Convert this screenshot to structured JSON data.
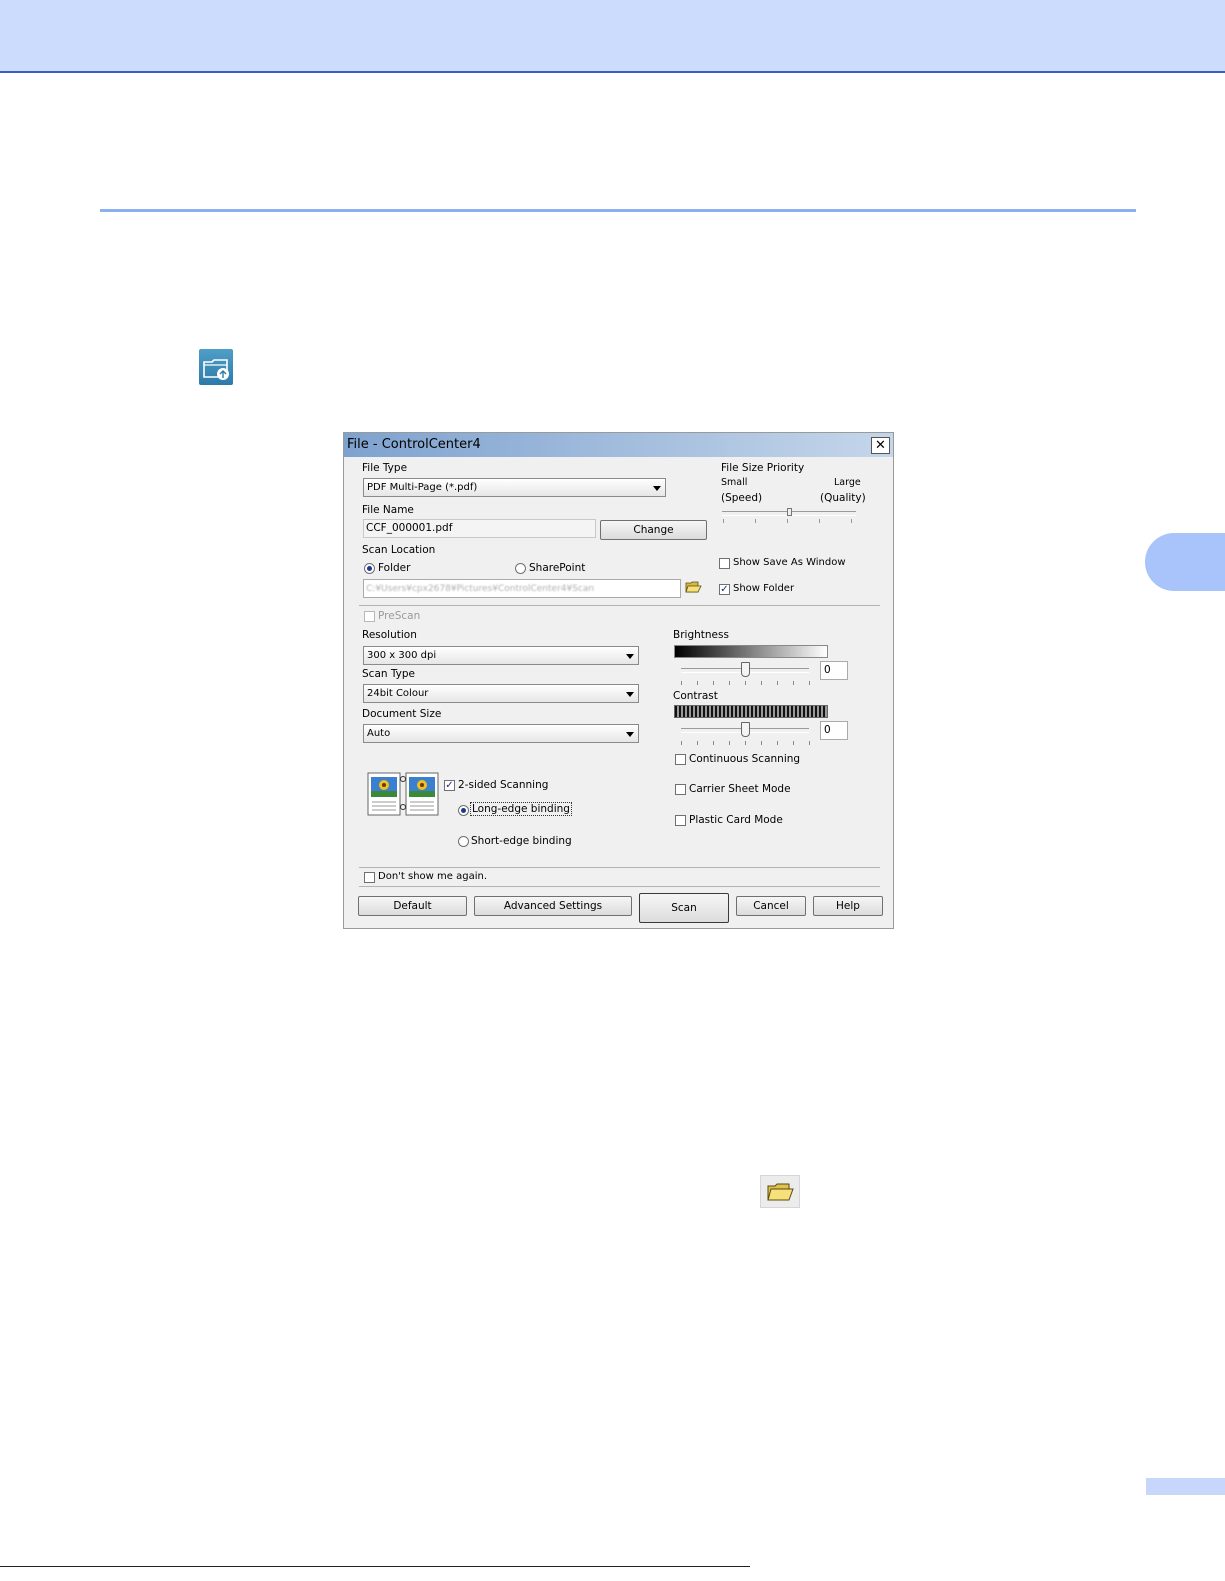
{
  "dialog": {
    "title": "File - ControlCenter4",
    "close_glyph": "✕",
    "file_type": {
      "label": "File Type",
      "value": "PDF Multi-Page (*.pdf)"
    },
    "file_size_priority": {
      "label": "File Size Priority",
      "small": "Small",
      "large": "Large",
      "speed": "(Speed)",
      "quality": "(Quality)",
      "level": 0.5
    },
    "file_name": {
      "label": "File Name",
      "value": "CCF_000001.pdf",
      "change_button": "Change"
    },
    "scan_location": {
      "label": "Scan Location",
      "folder": "Folder",
      "sharepoint": "SharePoint",
      "selected": "Folder",
      "path": "C:¥Users¥cpx2678¥Pictures¥ControlCenter4¥Scan"
    },
    "show_save_as_window": {
      "label": "Show Save As Window",
      "checked": false
    },
    "show_folder": {
      "label": "Show Folder",
      "checked": true
    },
    "prescan": {
      "label": "PreScan",
      "checked": false,
      "enabled": false
    },
    "resolution": {
      "label": "Resolution",
      "value": "300 x 300 dpi"
    },
    "scan_type": {
      "label": "Scan Type",
      "value": "24bit Colour"
    },
    "document_size": {
      "label": "Document Size",
      "value": "Auto"
    },
    "brightness": {
      "label": "Brightness",
      "value": "0"
    },
    "contrast": {
      "label": "Contrast",
      "value": "0"
    },
    "continuous_scanning": {
      "label": "Continuous Scanning",
      "checked": false
    },
    "carrier_sheet_mode": {
      "label": "Carrier Sheet Mode",
      "checked": false
    },
    "plastic_card_mode": {
      "label": "Plastic Card Mode",
      "checked": false
    },
    "two_sided": {
      "label": "2-sided Scanning",
      "checked": true,
      "long_edge": "Long-edge binding",
      "short_edge": "Short-edge binding",
      "selected": "Long-edge binding"
    },
    "dont_show_again": {
      "label": "Don't show me again.",
      "checked": false
    },
    "buttons": {
      "default": "Default",
      "advanced": "Advanced Settings",
      "scan": "Scan",
      "cancel": "Cancel",
      "help": "Help"
    },
    "check_glyph": "✓"
  },
  "colors": {
    "header_band": "#ccdcfc",
    "header_line": "#3a5bc8",
    "rule": "#8ab0f0",
    "tab": "#a9c3fb"
  }
}
